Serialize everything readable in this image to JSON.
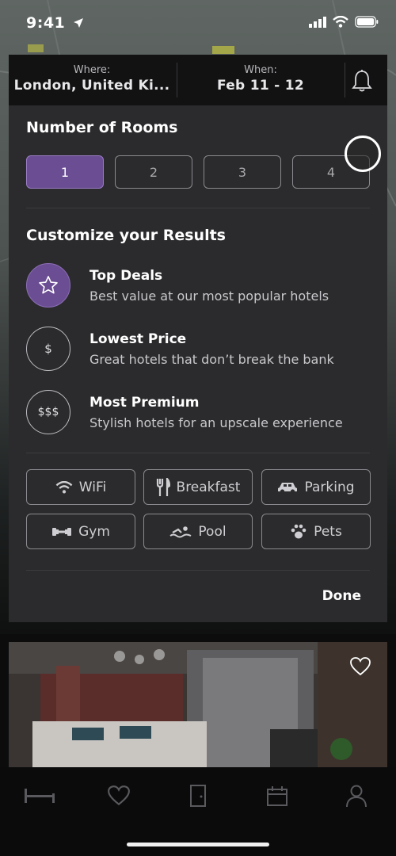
{
  "status": {
    "time": "9:41"
  },
  "header": {
    "where_label": "Where:",
    "where_value": "London, United Ki...",
    "when_label": "When:",
    "when_value": "Feb 11 - 12"
  },
  "rooms": {
    "title": "Number of Rooms",
    "options": [
      "1",
      "2",
      "3",
      "4"
    ],
    "selected": "1"
  },
  "customize": {
    "title": "Customize your Results",
    "options": [
      {
        "icon": "star-icon",
        "glyph": "☆",
        "title": "Top Deals",
        "subtitle": "Best value at our most popular hotels",
        "selected": true
      },
      {
        "icon": "dollar-icon",
        "glyph": "$",
        "title": "Lowest Price",
        "subtitle": "Great hotels that don’t break the bank",
        "selected": false
      },
      {
        "icon": "triple-dollar-icon",
        "glyph": "$$$",
        "title": "Most Premium",
        "subtitle": "Stylish hotels for an upscale experience",
        "selected": false
      }
    ]
  },
  "amenities": [
    {
      "label": "WiFi",
      "icon": "wifi-icon"
    },
    {
      "label": "Breakfast",
      "icon": "fork-knife-icon"
    },
    {
      "label": "Parking",
      "icon": "car-icon"
    },
    {
      "label": "Gym",
      "icon": "dumbbell-icon"
    },
    {
      "label": "Pool",
      "icon": "swimmer-icon"
    },
    {
      "label": "Pets",
      "icon": "paw-icon"
    }
  ],
  "done_label": "Done",
  "colors": {
    "accent": "#6b4d93",
    "panel": "#2b2b2d",
    "background": "#0c0c0d"
  },
  "tabbar": {
    "items": [
      "bed-icon",
      "heart-icon",
      "door-icon",
      "calendar-icon",
      "user-icon"
    ]
  }
}
